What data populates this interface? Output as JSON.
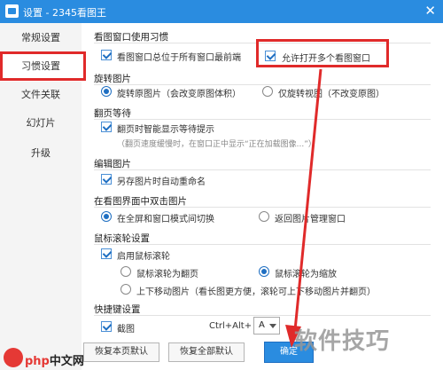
{
  "window": {
    "title": "设置 - 2345看图王",
    "close_glyph": "✕"
  },
  "sidebar": {
    "items": [
      {
        "label": "常规设置",
        "active": false
      },
      {
        "label": "习惯设置",
        "active": true
      },
      {
        "label": "文件关联",
        "active": false
      },
      {
        "label": "幻灯片",
        "active": false
      },
      {
        "label": "升级",
        "active": false
      }
    ]
  },
  "sections": {
    "habit": {
      "title": "看图窗口使用习惯",
      "opt_single_window": "看图窗口总位于所有窗口最前端",
      "opt_multi_window": "允许打开多个看图窗口"
    },
    "rotate": {
      "title": "旋转图片",
      "opt_rotate_image": "旋转原图片（会改变原图体积）",
      "opt_rotate_view": "仅旋转视图（不改变原图）"
    },
    "paging": {
      "title": "翻页等待",
      "opt_smart_hint": "翻页时智能显示等待提示",
      "hint": "（翻页速度缓慢时，在窗口正中显示“正在加载图像...”）"
    },
    "edit": {
      "title": "编辑图片",
      "opt_auto_rename": "另存图片时自动重命名"
    },
    "dblclick": {
      "title": "在看图界面中双击图片",
      "opt_fullscreen": "在全屏和窗口模式间切换",
      "opt_return": "返回图片管理窗口"
    },
    "wheel": {
      "title": "鼠标滚轮设置",
      "opt_enable": "启用鼠标滚轮",
      "opt_page": "鼠标滚轮为翻页",
      "opt_zoom": "鼠标滚轮为缩放",
      "opt_move": "上下移动图片（看长图更方便，滚轮可上下移动图片并翻页）"
    },
    "hotkey": {
      "title": "快捷键设置",
      "opt_screenshot": "截图",
      "combo": "Ctrl+Alt+",
      "key": "A"
    }
  },
  "buttons": {
    "restore_page": "恢复本页默认",
    "restore_all": "恢复全部默认",
    "ok": "确定"
  },
  "watermark": {
    "text": "软件技巧",
    "site_brand": "php",
    "site_suffix": "中文网"
  },
  "colors": {
    "titlebar": "#2a8ce0",
    "annotation": "#e02a2a",
    "accent": "#1f6fc2"
  }
}
